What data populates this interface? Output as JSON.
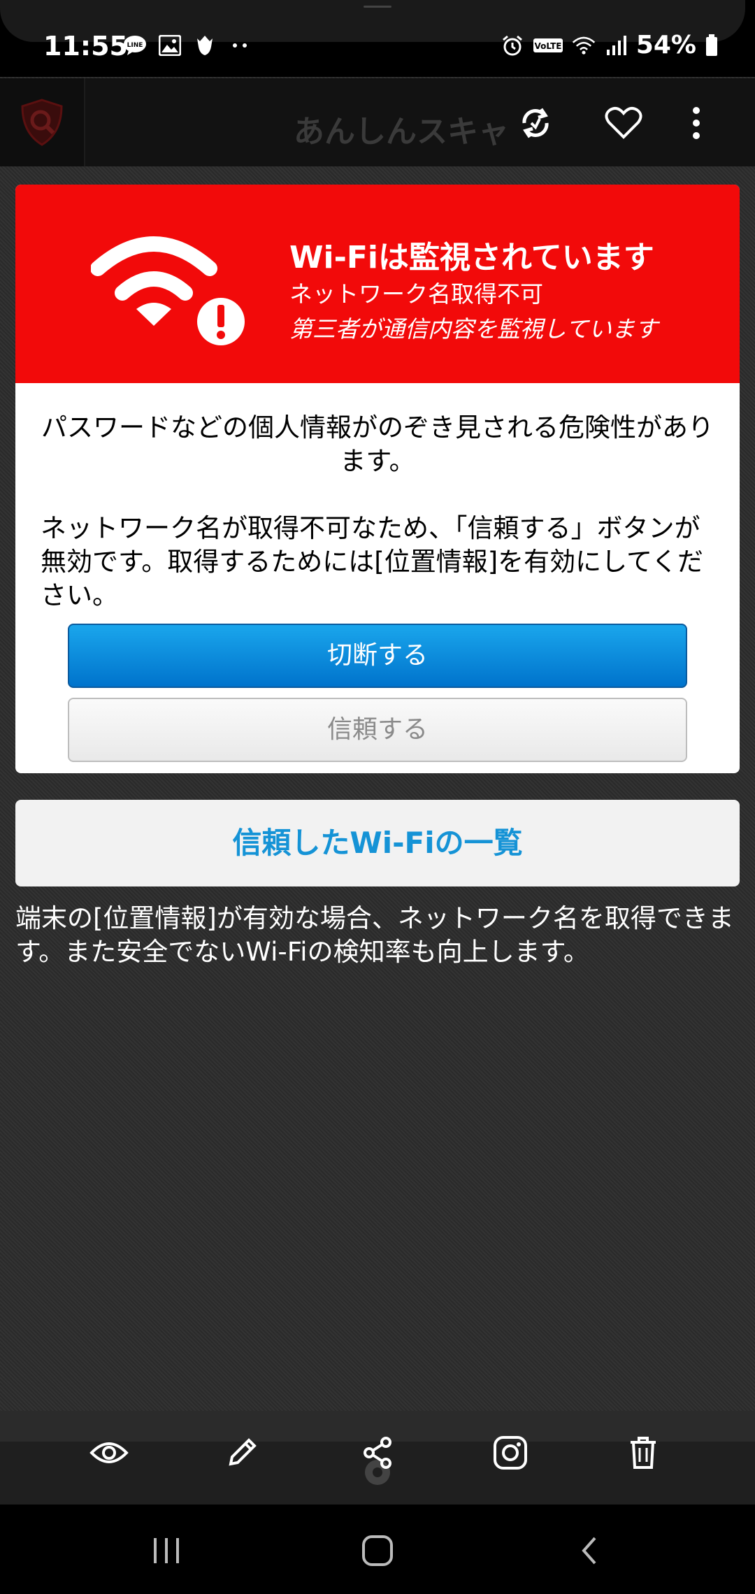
{
  "status_bar": {
    "time": "11:55",
    "battery": "54%",
    "left_icons": [
      "line-icon",
      "image-icon",
      "fox-icon",
      "more-dots-icon"
    ],
    "right_icons": [
      "alarm-icon",
      "volte-icon",
      "wifi-icon",
      "signal-icon",
      "battery-icon"
    ]
  },
  "app_bar": {
    "title": "あんしんスキャ",
    "icons": [
      "shield-search-logo-icon",
      "sync-icon",
      "heart-icon",
      "overflow-menu-icon"
    ]
  },
  "alert": {
    "title": "Wi-Fiは監視されています",
    "line1": "ネットワーク名取得不可",
    "line2": "第三者が通信内容を監視しています",
    "warning_text": "パスワードなどの個人情報がのぞき見される危険性があります。",
    "info_text": "ネットワーク名が取得不可なため、「信頼する」ボタンが無効です。取得するためには[位置情報]を有効にしてください。",
    "disconnect_label": "切断する",
    "trust_label": "信頼する",
    "colors": {
      "header": "#f20a0a",
      "primary": "#0a8ad8"
    }
  },
  "trusted_list_label": "信頼したWi-Fiの一覧",
  "note": "端末の[位置情報]が有効な場合、ネットワーク名を取得できます。また安全でないWi-Fiの検知率も向上します。",
  "toolbar": [
    "eye-icon",
    "pencil-icon",
    "share-icon",
    "instagram-icon",
    "trash-icon"
  ],
  "nav": [
    "recent-apps-icon",
    "home-icon",
    "back-icon"
  ]
}
